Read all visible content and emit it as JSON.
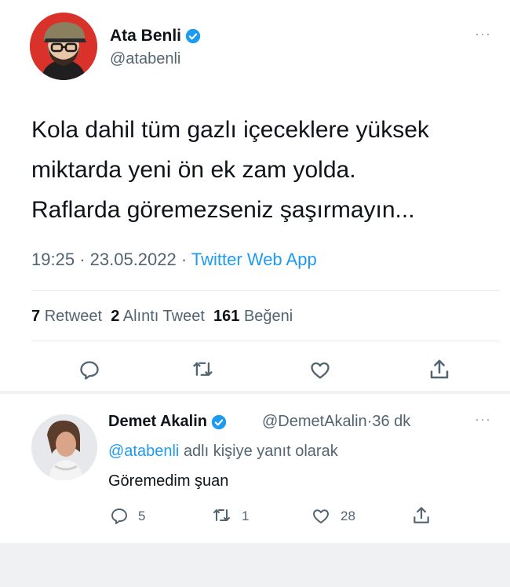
{
  "main_tweet": {
    "author_name": "Ata Benli",
    "author_handle": "@atabenli",
    "more": "···",
    "text_lines": [
      "Kola dahil tüm gazlı içeceklere yüksek",
      "miktarda yeni ön ek zam yolda.",
      "Raflarda göremezseniz şaşırmayın..."
    ],
    "time": "19:25",
    "date": "23.05.2022",
    "source": "Twitter Web App",
    "separator": "·",
    "stats": {
      "retweets": "7",
      "retweets_label": "Retweet",
      "quotes": "2",
      "quotes_label": "Alıntı Tweet",
      "likes": "161",
      "likes_label": "Beğeni"
    }
  },
  "reply_tweet": {
    "author_name": "Demet Akalin",
    "author_handle": "@DemetAkalin",
    "age": "36 dk",
    "separator": "·",
    "more": "···",
    "replying_to_handle": "@atabenli",
    "replying_to_suffix": "adlı kişiye yanıt olarak",
    "text": "Göremedim şuan",
    "replies": "5",
    "retweets": "1",
    "likes": "28"
  },
  "colors": {
    "link": "#1d9bf0",
    "verified": "#1d9bf0",
    "muted": "#536471"
  },
  "icons": [
    "reply-icon",
    "retweet-icon",
    "like-icon",
    "share-icon",
    "verified-badge-icon",
    "more-icon"
  ]
}
